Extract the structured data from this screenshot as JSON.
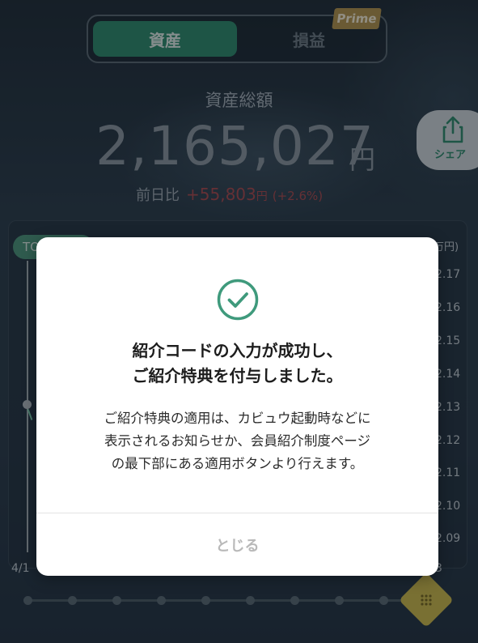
{
  "tabs": {
    "assets_label": "資産",
    "profit_label": "損益",
    "prime_badge": "Prime"
  },
  "summary": {
    "total_label": "資産総額",
    "total_amount": "2,165,027",
    "total_unit": "円",
    "change_label": "前日比",
    "change_value": "+55,803",
    "change_unit": "円",
    "change_percent": "(+2.6%)"
  },
  "share": {
    "label": "シェア",
    "icon": "share-icon"
  },
  "chart": {
    "tag_label": "TO",
    "y_unit": "万円)",
    "y_ticks": [
      "2.17",
      "2.16",
      "2.15",
      "2.14",
      "2.13",
      "2.12",
      "2.11",
      "2.10",
      "2.09"
    ],
    "x_first_tick": "4/1",
    "x_last_tick": "3"
  },
  "modal": {
    "icon": "check-circle-icon",
    "title_line1": "紹介コードの入力が成功し、",
    "title_line2": "ご紹介特典を付与しました。",
    "body_line1": "ご紹介特典の適用は、カビュウ起動時などに",
    "body_line2": "表示されるお知らせか、会員紹介制度ページ",
    "body_line3": "の最下部にある適用ボタンより行えます。",
    "close_label": "とじる"
  },
  "colors": {
    "accent_green": "#2f8f6e",
    "change_red": "#b04b4f",
    "prime_gold": "#b8974d",
    "slider_yellow": "#d4c04b"
  }
}
